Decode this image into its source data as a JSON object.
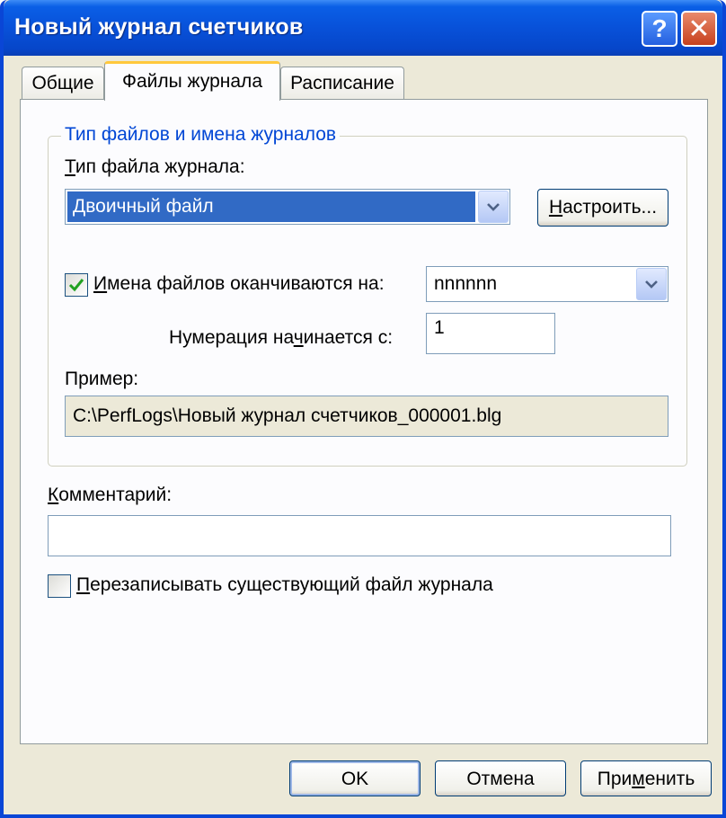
{
  "window": {
    "title": "Новый журнал счетчиков",
    "help_button": "?",
    "close_button": "✕"
  },
  "tabs": [
    {
      "label": "Общие"
    },
    {
      "label": "Файлы журнала"
    },
    {
      "label": "Расписание"
    }
  ],
  "group": {
    "title": "Тип файлов и имена журналов",
    "file_type_label_first": "Т",
    "file_type_label_rest": "ип файла журнала:",
    "file_type_value": "Двоичный файл",
    "configure_first": "Н",
    "configure_rest": "астроить...",
    "suffix_checkbox_checked": true,
    "suffix_label_first": "И",
    "suffix_label_rest": "мена файлов оканчиваются на:",
    "suffix_value": "nnnnnn",
    "numbering_label_a": "Нумерация на",
    "numbering_label_u": "ч",
    "numbering_label_b": "инается с:",
    "numbering_value": "1",
    "example_label": "Пример:",
    "example_value": "C:\\PerfLogs\\Новый журнал счетчиков_000001.blg"
  },
  "comment": {
    "label_first": "К",
    "label_rest": "омментарий:",
    "value": ""
  },
  "overwrite": {
    "checked": false,
    "label_first": "П",
    "label_rest": "ерезаписывать существующий файл журнала"
  },
  "footer": {
    "ok": "OK",
    "cancel": "Отмена",
    "apply_a": "При",
    "apply_u": "м",
    "apply_b": "енить"
  }
}
